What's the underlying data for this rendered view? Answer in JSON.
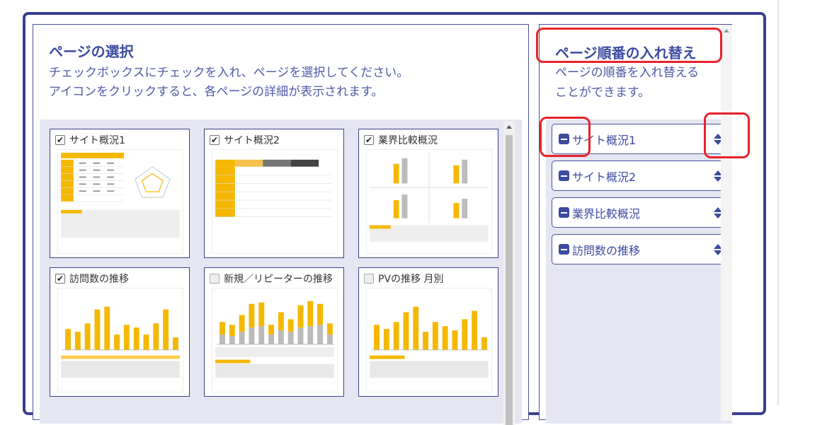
{
  "page_select": {
    "title": "ページの選択",
    "desc_line1": "チェックボックスにチェックを入れ、ページを選択してください。",
    "desc_line2": "アイコンをクリックすると、各ページの詳細が表示されます。",
    "cards": [
      {
        "label": "サイト概況1",
        "checked": true
      },
      {
        "label": "サイト概況2",
        "checked": true
      },
      {
        "label": "業界比較概況",
        "checked": true
      },
      {
        "label": "訪問数の推移",
        "checked": true
      },
      {
        "label": "新規／リピーターの推移",
        "checked": false
      },
      {
        "label": "PVの推移 月別",
        "checked": false
      }
    ]
  },
  "page_order": {
    "title": "ページ順番の入れ替え",
    "desc_line1": "ページの順番を入れ替える",
    "desc_line2": "ことができます。",
    "items": [
      {
        "label": "サイト概況1"
      },
      {
        "label": "サイト概況2"
      },
      {
        "label": "業界比較概況"
      },
      {
        "label": "訪問数の推移"
      }
    ]
  },
  "icons": {
    "check": "checkmark-icon",
    "remove": "minus-square-icon",
    "sort": "sort-updown-icon"
  },
  "colors": {
    "accent": "#3c4ba0",
    "panel_bg": "#e6e6f2",
    "bar": "#f5b800",
    "highlight": "#e8222a"
  }
}
